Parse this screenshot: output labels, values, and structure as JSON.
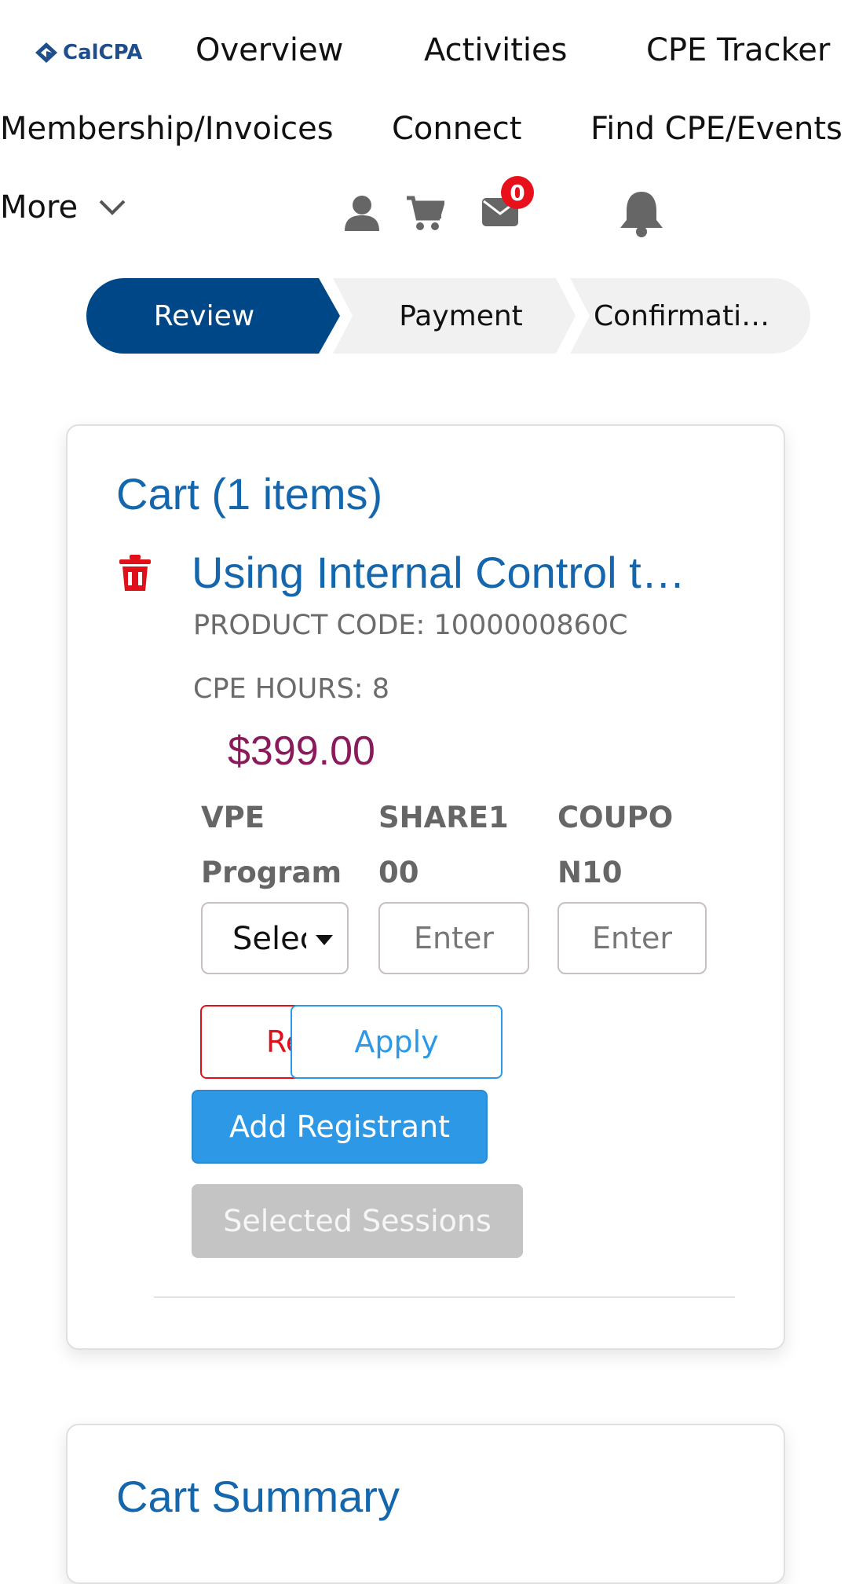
{
  "nav": {
    "logo_text": "CalCPA",
    "links": [
      "Overview",
      "Activities",
      "CPE Tracker",
      "Membership/Invoices",
      "Connect",
      "Find CPE/Events"
    ],
    "more_label": "More",
    "mail_count": "0",
    "icons": [
      "user-icon",
      "cart-icon",
      "mail-icon",
      "bell-icon",
      "chevron-down-icon"
    ]
  },
  "stepper": {
    "steps": [
      "Review",
      "Payment",
      "Confirmati…"
    ],
    "active": "Review",
    "active_color": "#004787"
  },
  "cart": {
    "title": "Cart (1 items)",
    "item": {
      "title": "Using Internal Control t…",
      "product_code": "PRODUCT CODE: 1000000860C",
      "cpe_hours": "CPE HOURS: 8",
      "price": "$399.00",
      "fields": [
        {
          "label_line1": "VPE",
          "label_line2": "Program",
          "value": "Selec",
          "type": "select"
        },
        {
          "label_line1": "SHARE1",
          "label_line2": "00",
          "placeholder": "Enter",
          "type": "input"
        },
        {
          "label_line1": "COUPO",
          "label_line2": "N10",
          "placeholder": "Enter",
          "type": "input"
        }
      ],
      "remove_label": "Re",
      "apply_label": "Apply",
      "add_registrant_label": "Add Registrant",
      "selected_sessions_label": "Selected Sessions"
    }
  },
  "summary": {
    "title": "Cart Summary"
  },
  "colors": {
    "link_blue": "#1466ad",
    "price": "#8a1a5c",
    "danger": "#e0101a",
    "primary_button": "#2d98e6",
    "disabled_button": "#c4c4c4"
  }
}
